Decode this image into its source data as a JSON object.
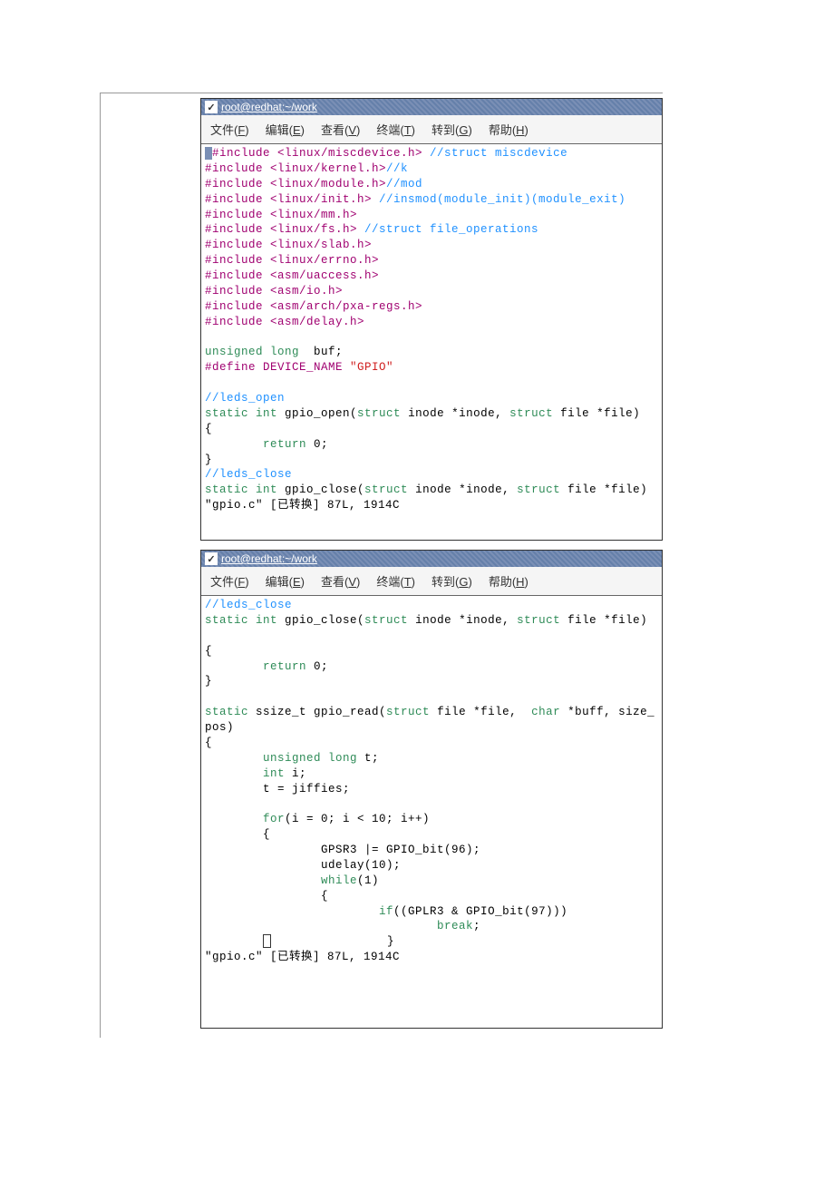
{
  "window1": {
    "title": "root@redhat:~/work",
    "menu": {
      "file": "文件(F)",
      "edit": "编辑(E)",
      "view": "查看(V)",
      "terminal": "终端(T)",
      "go": "转到(G)",
      "help": "帮助(H)"
    },
    "code": {
      "l1a": "#include <linux/miscdevice.h> ",
      "l1b": "//struct miscdevice",
      "l2a": "#include <linux/kernel.h>",
      "l2b": "//k",
      "l3a": "#include <linux/module.h>",
      "l3b": "//mod",
      "l4a": "#include <linux/init.h> ",
      "l4b": "//insmod(module_init)(module_exit)",
      "l5": "#include <linux/mm.h>",
      "l6a": "#include <linux/fs.h> ",
      "l6b": "//struct file_operations",
      "l7": "#include <linux/slab.h>",
      "l8": "#include <linux/errno.h>",
      "l9": "#include <asm/uaccess.h>",
      "l10": "#include <asm/io.h>",
      "l11": "#include <asm/arch/pxa-regs.h>",
      "l12": "#include <asm/delay.h>",
      "l14a": "unsigned",
      "l14b": " long",
      "l14c": "  buf;",
      "l15a": "#define DEVICE_NAME ",
      "l15b": "\"GPIO\"",
      "l17": "//leds_open",
      "l18a": "static",
      "l18b": " int",
      "l18c": " gpio_open(",
      "l18d": "struct",
      "l18e": " inode *inode, ",
      "l18f": "struct",
      "l18g": " file *file)",
      "l19": "{",
      "l20a": "        return",
      "l20b": " 0;",
      "l21": "}",
      "l22": "//leds_close",
      "l23a": "static",
      "l23b": " int",
      "l23c": " gpio_close(",
      "l23d": "struct",
      "l23e": " inode *inode, ",
      "l23f": "struct",
      "l23g": " file *file)",
      "status": "\"gpio.c\" [已转换] 87L, 1914C"
    }
  },
  "window2": {
    "title": "root@redhat:~/work",
    "menu": {
      "file": "文件(F)",
      "edit": "编辑(E)",
      "view": "查看(V)",
      "terminal": "终端(T)",
      "go": "转到(G)",
      "help": "帮助(H)"
    },
    "code": {
      "l1": "//leds_close",
      "l2a": "static",
      "l2b": " int",
      "l2c": " gpio_close(",
      "l2d": "struct",
      "l2e": " inode *inode, ",
      "l2f": "struct",
      "l2g": " file *file)",
      "l4": "{",
      "l5a": "        return",
      "l5b": " 0;",
      "l6": "}",
      "l8a": "static",
      "l8b": " ssize_t gpio_read(",
      "l8c": "struct",
      "l8d": " file *file,  ",
      "l8e": "char",
      "l8f": " *buff, size_",
      "l9": "pos)",
      "l10": "{",
      "l11a": "        unsigned",
      "l11b": " long",
      "l11c": " t;",
      "l12a": "        int",
      "l12b": " i;",
      "l13": "        t = jiffies;",
      "l15a": "        for",
      "l15b": "(i = 0; i < 10; i++)",
      "l16": "        {",
      "l17": "                GPSR3 |= GPIO_bit(96);",
      "l18": "                udelay(10);",
      "l19a": "                while",
      "l19b": "(1)",
      "l20": "                {",
      "l21a": "                        if",
      "l21b": "((GPLR3 & GPIO_bit(97)))",
      "l22a": "                                break",
      "l22b": ";",
      "l23": "                }",
      "status": "\"gpio.c\" [已转换] 87L, 1914C"
    }
  }
}
